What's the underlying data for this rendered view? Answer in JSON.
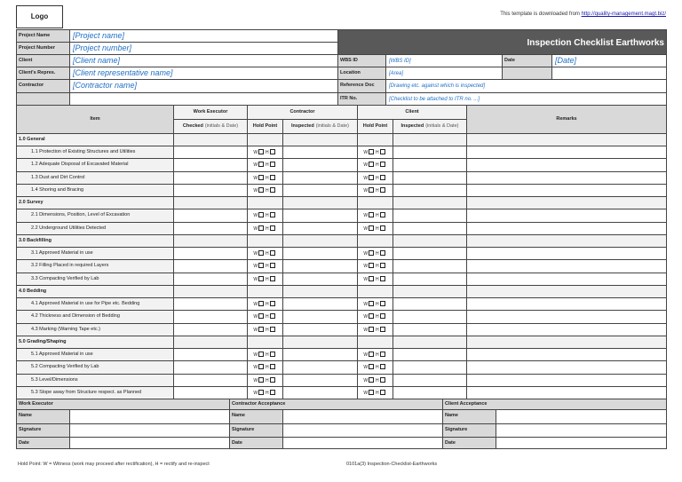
{
  "logo": "Logo",
  "download_note": {
    "text": "This template is downloaded from ",
    "link": "http://quality-management.magt.biz/"
  },
  "title": "Inspection Checklist Earthworks",
  "project": [
    {
      "label": "Project Name",
      "value": "[Project name]"
    },
    {
      "label": "Project Number",
      "value": "[Project number]"
    },
    {
      "label": "Client",
      "value": "[Client name]"
    },
    {
      "label": "Client's Repres.",
      "value": "[Client representative name]"
    },
    {
      "label": "Contractor",
      "value": "[Contractor name]"
    },
    {
      "label": "",
      "value": ""
    }
  ],
  "right": {
    "wbs_label": "WBS ID",
    "wbs_value": "[WBS ID]",
    "date_label": "Date",
    "date_value": "[Date]",
    "location_label": "Location",
    "location_value": "[Area]",
    "ref_label": "Reference Doc",
    "ref_value": "[Drawing etc. against which is inspected]",
    "itr_label": "ITR No.",
    "itr_value": "[Checklist to be attached to ITR no. ...]"
  },
  "headers": {
    "item": "Item",
    "work_executor": "Work Executor",
    "contractor": "Contractor",
    "client": "Client",
    "remarks": "Remarks",
    "checked": "Checked",
    "checked_note": "(initials & Date)",
    "hold_point": "Hold Point",
    "inspected": "Inspected",
    "inspected_note": "(initials & Date)",
    "w": "W",
    "h": "H"
  },
  "rows": [
    {
      "type": "section",
      "label": "1.0 General"
    },
    {
      "type": "item",
      "label": "1.1 Protection of Existing Structures and Utilities"
    },
    {
      "type": "item",
      "label": "1.2 Adequate Disposal of Excavated Material"
    },
    {
      "type": "item",
      "label": "1.3 Dust and Dirt Control"
    },
    {
      "type": "item",
      "label": "1.4 Shoring and Bracing"
    },
    {
      "type": "section",
      "label": "2.0 Survey"
    },
    {
      "type": "item",
      "label": "2.1 Dimensions, Position, Level of Excavation"
    },
    {
      "type": "item",
      "label": "2.2 Underground Utilities Detected"
    },
    {
      "type": "section",
      "label": "3.0 Backfilling"
    },
    {
      "type": "item",
      "label": "3.1 Approved Material in use"
    },
    {
      "type": "item",
      "label": "3.2 Filling Placed in required Layers"
    },
    {
      "type": "item",
      "label": "3.3 Compacting Verified by Lab"
    },
    {
      "type": "section",
      "label": "4.0 Bedding"
    },
    {
      "type": "item",
      "label": "4.1 Approved Material in use for Pipe etc. Bedding"
    },
    {
      "type": "item",
      "label": "4.2 Thickness and Dimension of Bedding"
    },
    {
      "type": "item",
      "label": "4.3 Marking (Warning Tape etc.)"
    },
    {
      "type": "section",
      "label": "5.0 Grading/Shaping"
    },
    {
      "type": "item",
      "label": "5.1 Approved Material in use"
    },
    {
      "type": "item",
      "label": "5.2 Compacting Verified by Lab"
    },
    {
      "type": "item",
      "label": "5.3 Level/Dimensions"
    },
    {
      "type": "item",
      "label": "5.3 Slope away from Structure respect. as Planned"
    }
  ],
  "signoff": [
    {
      "title": "Work Executor",
      "name": "Name",
      "signature": "Signature",
      "date": "Date"
    },
    {
      "title": "Contractor Acceptance",
      "name": "Name",
      "signature": "Signature",
      "date": "Date"
    },
    {
      "title": "Client Acceptance",
      "name": "Name",
      "signature": "Signature",
      "date": "Date"
    }
  ],
  "footer": {
    "legend": "Hold Point: W = Witness (work may proceed after rectification), H = rectify and re-inspect",
    "doc_id": "0101a(3) Inspection-Checklist-Earthworks"
  }
}
